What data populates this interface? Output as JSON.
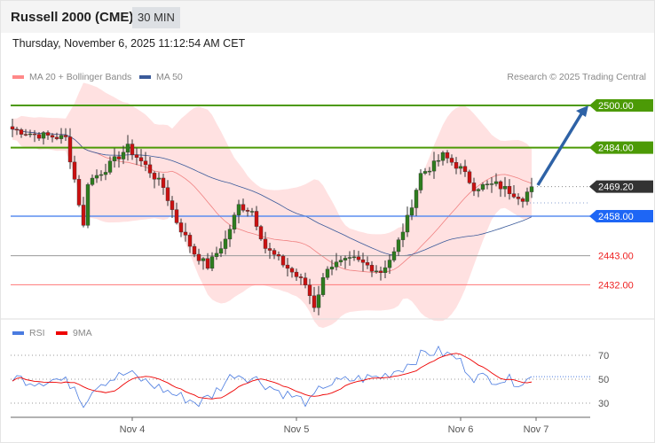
{
  "header": {
    "title": "Russell 2000 (CME)",
    "timeframe": "30 MIN",
    "datetime": "Thursday, November 6, 2025 11:12:54 AM CET"
  },
  "legend": {
    "ma20": "MA 20 + Bollinger Bands",
    "ma50": "MA 50",
    "credit": "Research © 2025 Trading Central",
    "rsi": "RSI",
    "rsi_ma": "9MA"
  },
  "colors": {
    "green": "#4c9a06",
    "blue": "#1e66f5",
    "dark": "#333333",
    "red": "#ee2222",
    "ma20": "#f08080",
    "ma50": "#3a5a9a",
    "band": "#ffdada",
    "arrow": "#2e62a6"
  },
  "chart_data": {
    "type": "candlestick",
    "levels": [
      {
        "value": 2500.0,
        "label": "2500.00",
        "kind": "resistance"
      },
      {
        "value": 2484.0,
        "label": "2484.00",
        "kind": "resistance"
      },
      {
        "value": 2469.2,
        "label": "2469.20",
        "kind": "last"
      },
      {
        "value": 2458.0,
        "label": "2458.00",
        "kind": "pivot"
      },
      {
        "value": 2443.0,
        "label": "2443.00",
        "kind": "support"
      },
      {
        "value": 2432.0,
        "label": "2432.00",
        "kind": "support"
      }
    ],
    "price_path": [
      [
        0,
        2491
      ],
      [
        5,
        2489
      ],
      [
        12,
        2487.6
      ],
      [
        14,
        2472
      ],
      [
        16,
        2454
      ],
      [
        17,
        2471
      ],
      [
        21,
        2476
      ],
      [
        26,
        2484
      ],
      [
        30,
        2477
      ],
      [
        34,
        2469
      ],
      [
        37,
        2456
      ],
      [
        41,
        2444
      ],
      [
        44,
        2439
      ],
      [
        48,
        2449
      ],
      [
        51,
        2462
      ],
      [
        54,
        2460
      ],
      [
        57,
        2446
      ],
      [
        61,
        2440
      ],
      [
        66,
        2432
      ],
      [
        68,
        2424
      ],
      [
        71,
        2439
      ],
      [
        77,
        2441.5
      ],
      [
        83,
        2437
      ],
      [
        86,
        2444
      ],
      [
        89,
        2457
      ],
      [
        92,
        2474
      ],
      [
        95,
        2477.5
      ],
      [
        97,
        2481
      ],
      [
        101,
        2476
      ],
      [
        104,
        2469
      ],
      [
        109,
        2470
      ],
      [
        115,
        2465
      ],
      [
        117,
        2469.2
      ]
    ],
    "rsi_path": [
      [
        0,
        52
      ],
      [
        5,
        48
      ],
      [
        10,
        50
      ],
      [
        14,
        45
      ],
      [
        16,
        30
      ],
      [
        19,
        46
      ],
      [
        26,
        55
      ],
      [
        30,
        48
      ],
      [
        36,
        38
      ],
      [
        42,
        30
      ],
      [
        45,
        37
      ],
      [
        50,
        55
      ],
      [
        55,
        50
      ],
      [
        60,
        40
      ],
      [
        67,
        30
      ],
      [
        70,
        45
      ],
      [
        77,
        50
      ],
      [
        83,
        52
      ],
      [
        88,
        60
      ],
      [
        93,
        72
      ],
      [
        96,
        73
      ],
      [
        100,
        68
      ],
      [
        104,
        52
      ],
      [
        110,
        50
      ],
      [
        115,
        48
      ],
      [
        117,
        51
      ]
    ],
    "x_labels": [
      {
        "index": 27,
        "label": "Nov 4"
      },
      {
        "index": 64,
        "label": "Nov 5"
      },
      {
        "index": 101,
        "label": "Nov 6"
      },
      {
        "index": 118,
        "label": "Nov 7"
      }
    ],
    "rsi_levels": [
      {
        "value": 70,
        "label": "70"
      },
      {
        "value": 50,
        "label": "50"
      },
      {
        "value": 30,
        "label": "30"
      }
    ],
    "forecast_target": 2500
  }
}
